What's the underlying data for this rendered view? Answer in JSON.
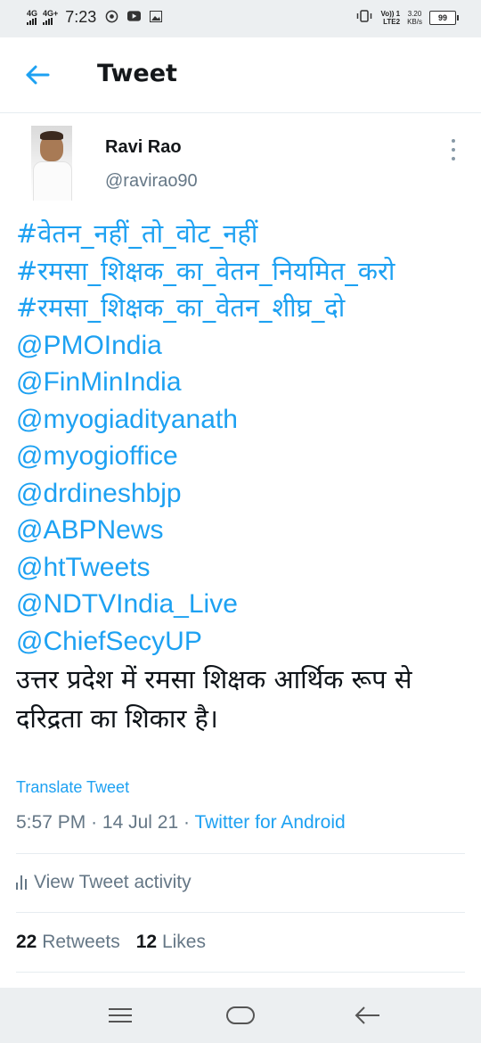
{
  "status_bar": {
    "network_1": "4G",
    "network_2": "4G+",
    "time": "7:23",
    "volte_1": "Vo)) 1",
    "volte_2": "LTE2",
    "speed_value": "3.20",
    "speed_unit": "KB/s",
    "battery": "99"
  },
  "header": {
    "title": "Tweet",
    "back_icon": "arrow-left-icon",
    "accent_color": "#1da1f2"
  },
  "author": {
    "name": "Ravi Rao",
    "handle": "@ravirao90",
    "more_icon": "more-vertical-icon"
  },
  "tweet": {
    "hashtags": [
      "#वेतन_नहीं_तो_वोट_नहीं",
      "#रमसा_शिक्षक_का_वेतन_नियमित_करो",
      "#रमसा_शिक्षक_का_वेतन_शीघ्र_दो"
    ],
    "mentions": [
      "@PMOIndia",
      "@FinMinIndia",
      "@myogiadityanath",
      "@myogioffice",
      "@drdineshbjp",
      "@ABPNews",
      "@htTweets",
      "@NDTVIndia_Live",
      "@ChiefSecyUP"
    ],
    "text": "उत्तर प्रदेश में रमसा शिक्षक आर्थिक रूप से दरिद्रता का शिकार है।",
    "translate_label": "Translate Tweet",
    "time": "5:57 PM",
    "date": "14 Jul 21",
    "separator": "·",
    "source": "Twitter for Android"
  },
  "activity": {
    "label": "View Tweet activity",
    "icon": "bar-chart-icon"
  },
  "stats": {
    "retweets_count": "22",
    "retweets_label": "Retweets",
    "likes_count": "12",
    "likes_label": "Likes"
  },
  "nav_bar": {
    "menu_icon": "menu-icon",
    "home_icon": "home-pill-icon",
    "back_icon": "back-arrow-icon"
  }
}
